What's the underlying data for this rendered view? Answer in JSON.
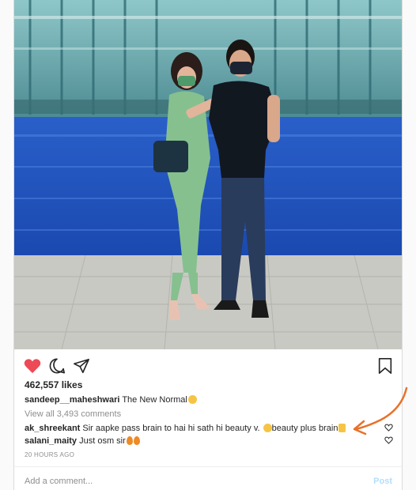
{
  "post": {
    "likes": "462,557 likes",
    "author": "sandeep__maheshwari",
    "caption_text": "The New Normal",
    "view_all": "View all 3,493 comments",
    "timestamp": "20 HOURS AGO"
  },
  "comments": [
    {
      "user": "ak_shreekant",
      "text": "Sir aapke pass brain to hai hi sath hi beauty v.",
      "text2": "beauty plus brain"
    },
    {
      "user": "salani_maity",
      "text": "Just osm sir"
    }
  ],
  "composer": {
    "placeholder": "Add a comment...",
    "post_label": "Post"
  },
  "colors": {
    "like_red": "#ed4956",
    "annotation_arrow": "#e8712a",
    "pool_blue": "#1e58c8"
  },
  "icons": [
    "heart-filled-icon",
    "comment-icon",
    "share-icon",
    "bookmark-icon",
    "heart-outline-icon"
  ]
}
